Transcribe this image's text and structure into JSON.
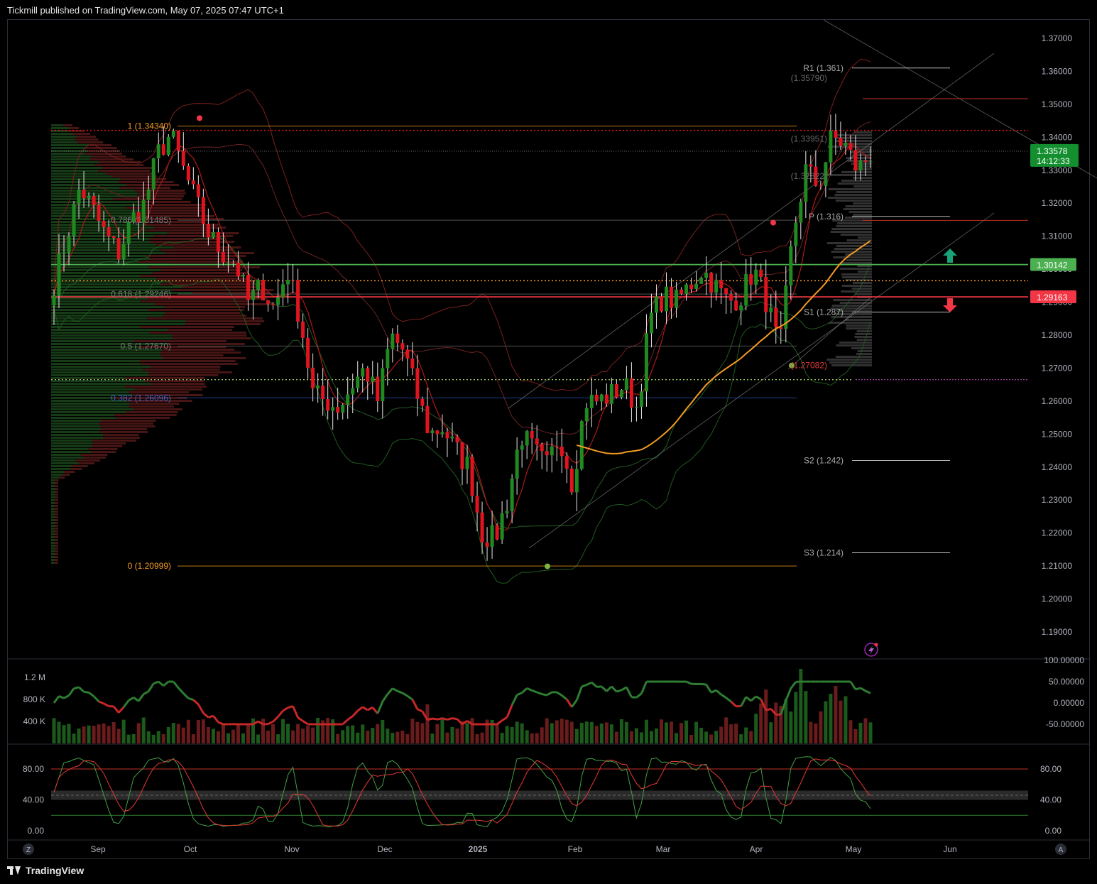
{
  "header": {
    "text": "Tickmill published on TradingView.com, May 07, 2025 07:47 UTC+1"
  },
  "footer": {
    "brand": "TradingView"
  },
  "colors": {
    "bull": "#1f8a1f",
    "bear": "#e0141e",
    "ema": "#f59b23",
    "green_line": "#4caf50",
    "red_line": "#f23645",
    "fib": "#f59b23"
  },
  "icons": {
    "corner_left": "Z",
    "corner_right": "A",
    "lightning": "lightning-icon",
    "arrow_up": "arrow-up-icon",
    "arrow_down": "arrow-down-icon"
  },
  "chart_data": {
    "type": "candlestick",
    "ylim": [
      1.185,
      1.377
    ],
    "y_ticks": [
      "1.37000",
      "1.36000",
      "1.35000",
      "1.34000",
      "1.33000",
      "1.32000",
      "1.31000",
      "1.30000",
      "1.29000",
      "1.28000",
      "1.27000",
      "1.26000",
      "1.25000",
      "1.24000",
      "1.23000",
      "1.22000",
      "1.21000",
      "1.20000",
      "1.19000"
    ],
    "x_ticks": [
      "Sep",
      "Oct",
      "Nov",
      "Dec",
      "2025",
      "Feb",
      "Mar",
      "Apr",
      "May",
      "Jun"
    ],
    "price_marker": {
      "price": "1.33578",
      "countdown": "14:12:33",
      "value": 1.33578
    },
    "level_markers": [
      {
        "label": "1.30142",
        "value": 1.30142
      },
      {
        "label": "1.29163",
        "value": 1.29163
      }
    ],
    "fib_levels": [
      {
        "label": "1 (1.34340)",
        "value": 1.3434
      },
      {
        "label": "0.786 (1.31485)",
        "value": 1.31485
      },
      {
        "label": "0.618 (1.29246)",
        "value": 1.29246
      },
      {
        "label": "0.5 (1.27670)",
        "value": 1.2767
      },
      {
        "label": "0.382 (1.26096)",
        "value": 1.26096
      },
      {
        "label": "0 (1.20999)",
        "value": 1.20999
      }
    ],
    "pivot_levels": [
      {
        "label": "R1 (1.361)",
        "value": 1.361
      },
      {
        "label": "P (1.316)",
        "value": 1.316
      },
      {
        "label": "S1 (1.287)",
        "value": 1.287
      },
      {
        "label": "S2 (1.242)",
        "value": 1.242
      },
      {
        "label": "S3 (1.214)",
        "value": 1.214
      }
    ],
    "minor_labels": [
      {
        "label": "(1.35790)",
        "value": 1.3579
      },
      {
        "label": "(1.33951)",
        "value": 1.33951
      },
      {
        "label": "(1.32822)",
        "value": 1.32822
      },
      {
        "label": "(1.27082)",
        "value": 1.27082
      }
    ],
    "anchor_closes": [
      1.296,
      1.31,
      1.325,
      1.318,
      1.31,
      1.305,
      1.315,
      1.32,
      1.335,
      1.341,
      1.33,
      1.32,
      1.31,
      1.305,
      1.302,
      1.29,
      1.295,
      1.288,
      1.3,
      1.285,
      1.262,
      1.26,
      1.258,
      1.265,
      1.27,
      1.26,
      1.28,
      1.275,
      1.262,
      1.25,
      1.252,
      1.245,
      1.24,
      1.22,
      1.218,
      1.23,
      1.25,
      1.245,
      1.24,
      1.25,
      1.235,
      1.26,
      1.26,
      1.262,
      1.265,
      1.258,
      1.285,
      1.292,
      1.29,
      1.295,
      1.3,
      1.295,
      1.29,
      1.292,
      1.3,
      1.29,
      1.275,
      1.31,
      1.33,
      1.325,
      1.34,
      1.338,
      1.33,
      1.335
    ],
    "volume_panel": {
      "y_ticks": [
        "1.2 M",
        "800 K",
        "400 K"
      ],
      "osc_ticks": [
        "100.00000",
        "50.00000",
        "0.00000",
        "-50.00000"
      ]
    },
    "stoch_panel": {
      "y_ticks": [
        "80.00",
        "40.00",
        "0.00"
      ],
      "upper": 80,
      "lower": 20
    }
  }
}
